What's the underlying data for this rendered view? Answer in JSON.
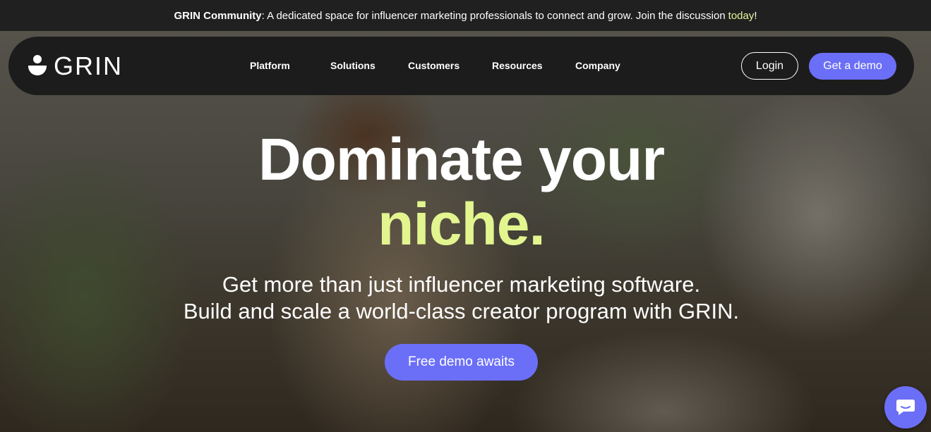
{
  "announcement": {
    "title": "GRIN Community",
    "text": ": A dedicated space for influencer marketing professionals to connect and grow. Join the discussion",
    "link": "today",
    "suffix": "!"
  },
  "nav": {
    "logo_text": "GRIN",
    "menu": [
      "Platform",
      "Solutions",
      "Customers",
      "Resources",
      "Company"
    ],
    "login": "Login",
    "get_demo": "Get a demo"
  },
  "hero": {
    "headline_line1": "Dominate your",
    "headline_accent": "niche.",
    "subhead_line1": "Get more than just influencer marketing software.",
    "subhead_line2": "Build and scale a world-class creator program with GRIN.",
    "cta": "Free demo awaits"
  },
  "colors": {
    "accent": "#6b6ff7",
    "highlight": "#e2f58f",
    "nav_bg": "#1c1c1c"
  },
  "icons": {
    "chat": "chat-bubble-icon",
    "logo": "grin-smile-logo-icon"
  }
}
